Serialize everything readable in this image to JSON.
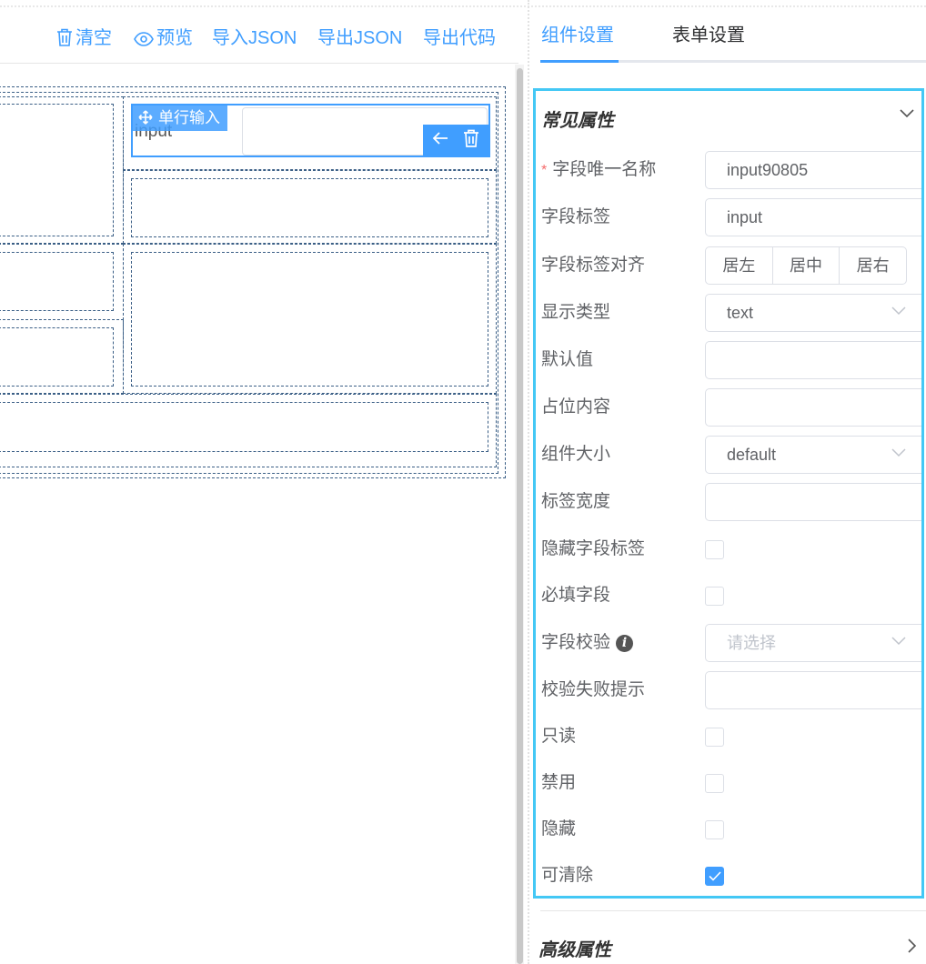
{
  "toolbar": {
    "clear_label": "清空",
    "preview_label": "预览",
    "import_json_label": "导入JSON",
    "export_json_label": "导出JSON",
    "export_code_label": "导出代码"
  },
  "canvas": {
    "selected_widget": {
      "drag_label": "单行输入",
      "field_label": "input"
    }
  },
  "tabs": {
    "widget_settings": "组件设置",
    "form_settings": "表单设置"
  },
  "common_section": {
    "title": "常见属性",
    "field_name": {
      "label": "字段唯一名称",
      "required_mark": "*",
      "value": "input90805"
    },
    "field_label": {
      "label": "字段标签",
      "value": "input"
    },
    "label_align": {
      "label": "字段标签对齐",
      "options": [
        "居左",
        "居中",
        "居右"
      ]
    },
    "display_type": {
      "label": "显示类型",
      "value": "text"
    },
    "default_value": {
      "label": "默认值",
      "value": ""
    },
    "placeholder": {
      "label": "占位内容",
      "value": ""
    },
    "size": {
      "label": "组件大小",
      "value": "default"
    },
    "label_width": {
      "label": "标签宽度",
      "value": ""
    },
    "hide_label": {
      "label": "隐藏字段标签",
      "checked": false
    },
    "required": {
      "label": "必填字段",
      "checked": false
    },
    "validation": {
      "label": "字段校验",
      "placeholder": "请选择"
    },
    "validation_hint": {
      "label": "校验失败提示",
      "value": ""
    },
    "readonly": {
      "label": "只读",
      "checked": false
    },
    "disabled": {
      "label": "禁用",
      "checked": false
    },
    "hidden": {
      "label": "隐藏",
      "checked": false
    },
    "clearable": {
      "label": "可清除",
      "checked": true
    }
  },
  "advanced_section": {
    "title": "高级属性"
  },
  "colors": {
    "accent": "#409eff",
    "panel_border": "#44c8f5",
    "grid_dash": "#3b5f86"
  }
}
